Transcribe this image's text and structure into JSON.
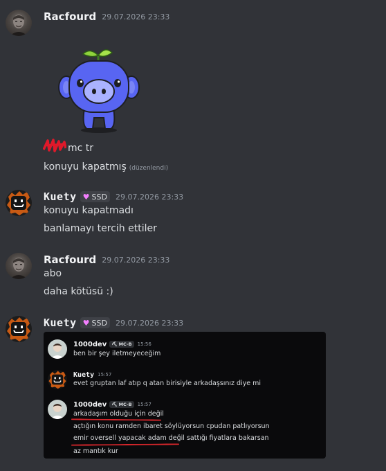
{
  "messages": [
    {
      "author": "Racfourd",
      "timestamp": "29.07.2026 23:33",
      "sticker": "wumpus-sprout-sticker",
      "lines": [
        "mc tr",
        "konuyu kapatmış"
      ],
      "edited_label": "(düzenlendi)"
    },
    {
      "author": "Kuety",
      "badge": "SSD",
      "timestamp": "29.07.2026 23:33",
      "lines": [
        "konuyu kapatmadı",
        "banlamayı tercih ettiler"
      ]
    },
    {
      "author": "Racfourd",
      "timestamp": "29.07.2026 23:33",
      "lines": [
        "abo",
        "daha kötüsü :)"
      ]
    },
    {
      "author": "Kuety",
      "badge": "SSD",
      "timestamp": "29.07.2026 23:33"
    }
  ],
  "embedded_screenshot": {
    "messages": [
      {
        "author": "1000dev",
        "badge": "MC-B",
        "timestamp": "15:56",
        "lines": [
          "ben bir şey iletmeyeceğim"
        ]
      },
      {
        "author": "Kuety",
        "timestamp": "15:57",
        "lines": [
          "evet gruptan laf atıp q atan birisiyle arkadaşsınız diye mi"
        ]
      },
      {
        "author": "1000dev",
        "badge": "MC-B",
        "timestamp": "15:57",
        "lines": [
          "arkadaşım olduğu için değil",
          "açtığın konu ramden ibaret söylüyorsun cpudan patlıyorsun",
          "emir oversell yapacak adam değil sattığı fiyatlara bakarsan",
          "az mantık kur"
        ]
      }
    ]
  },
  "colors": {
    "background": "#313338",
    "text": "#dbdee1",
    "muted": "#949ba4",
    "badge_heart": "#f47fff",
    "annotation_red": "#d8262b"
  }
}
